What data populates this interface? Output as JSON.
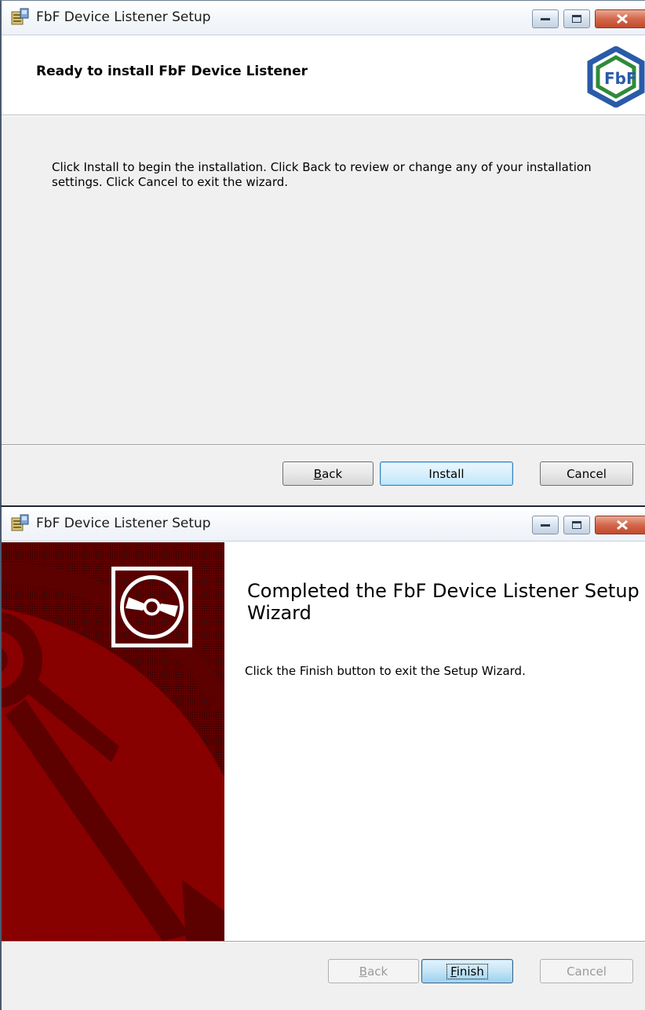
{
  "window1": {
    "title": "FbF Device Listener Setup",
    "header_title": "Ready to install FbF Device Listener",
    "logo_text": "FbF",
    "body_text": "Click Install to begin the installation. Click Back to review or change any of your installation settings. Click Cancel to exit the wizard.",
    "buttons": {
      "back_mnemonic": "B",
      "back_rest": "ack",
      "install": "Install",
      "cancel": "Cancel"
    }
  },
  "window2": {
    "title": "FbF Device Listener Setup",
    "heading": "Completed the FbF Device Listener Setup Wizard",
    "body_text": "Click the Finish button to exit the Setup Wizard.",
    "buttons": {
      "back_mnemonic": "B",
      "back_rest": "ack",
      "finish_mnemonic": "F",
      "finish_rest": "inish",
      "cancel": "Cancel"
    }
  },
  "colors": {
    "titlebar_bg": "#f3f6fa",
    "body_bg": "#f0f0f0",
    "banner_red": "#7a0000",
    "logo_blue": "#2a5aa8",
    "logo_green": "#2f8a3a",
    "primary_button": "#bee6fd"
  }
}
